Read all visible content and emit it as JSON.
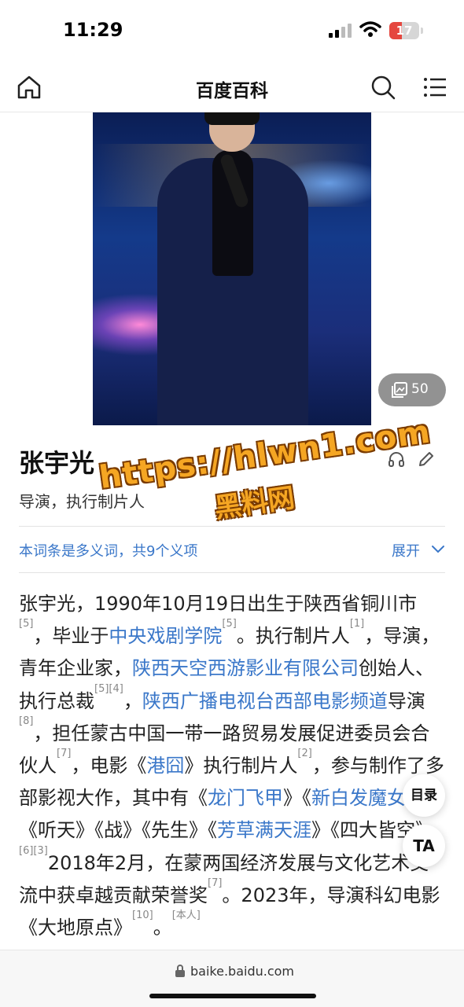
{
  "status_bar": {
    "time": "11:29",
    "battery": "17",
    "battery_color": "#e5473f"
  },
  "navbar": {
    "title": "百度百科"
  },
  "hero": {
    "gallery_count": "50"
  },
  "entry": {
    "title": "张宇光",
    "subtitle": "导演，执行制片人",
    "polysemy_notice": "本词条是多义词，共9个义项",
    "expand_label": "展开"
  },
  "body": [
    {
      "t": "张宇光，1990年10月19日出生于陕西省铜川市"
    },
    {
      "sup": "[5]"
    },
    {
      "t": "，毕业于"
    },
    {
      "link": "中央戏剧学院"
    },
    {
      "sup": "[5]"
    },
    {
      "t": "。执行制片人"
    },
    {
      "sup": "[1]"
    },
    {
      "t": "，导演，青年企业家，"
    },
    {
      "link": "陕西天空西游影业有限公司"
    },
    {
      "t": "创始人、执行总裁"
    },
    {
      "sup": "[5][4]"
    },
    {
      "t": "，"
    },
    {
      "link": "陕西广播电视台西部电影频道"
    },
    {
      "t": "导演"
    },
    {
      "sup": "[8]"
    },
    {
      "t": "，担任蒙古中国一带一路贸易发展促进委员会合伙人"
    },
    {
      "sup": "[7]"
    },
    {
      "t": "，电影《"
    },
    {
      "link": "港囧"
    },
    {
      "t": "》执行制片人"
    },
    {
      "sup": "[2]"
    },
    {
      "t": "，参与制作了多部影视大作，其中有《"
    },
    {
      "link": "龙门飞甲"
    },
    {
      "t": "》《"
    },
    {
      "link": "新白发魔女传"
    },
    {
      "t": "》《听天》《战》《先生》《"
    },
    {
      "link": "芳草满天涯"
    },
    {
      "t": "》《四大皆空》。"
    },
    {
      "sup": "[6][3]"
    },
    {
      "t": "2018年2月，在蒙两国经济发展与文化艺术交流中获卓越贡献荣誉奖"
    },
    {
      "sup": "[7]"
    },
    {
      "t": "。2023年，导演科幻电影《大地原点》"
    },
    {
      "sup": "[10]"
    },
    {
      "t": "。"
    },
    {
      "sup": "[本人]"
    }
  ],
  "floating": {
    "toc_label": "目录",
    "font_label": "TA"
  },
  "watermark": {
    "url": "https://hlwn1.com",
    "name": "黑料网"
  },
  "bottom_bar": {
    "url": "baike.baidu.com"
  },
  "colors": {
    "link": "#3a77c9",
    "watermark": "#f5a623"
  }
}
